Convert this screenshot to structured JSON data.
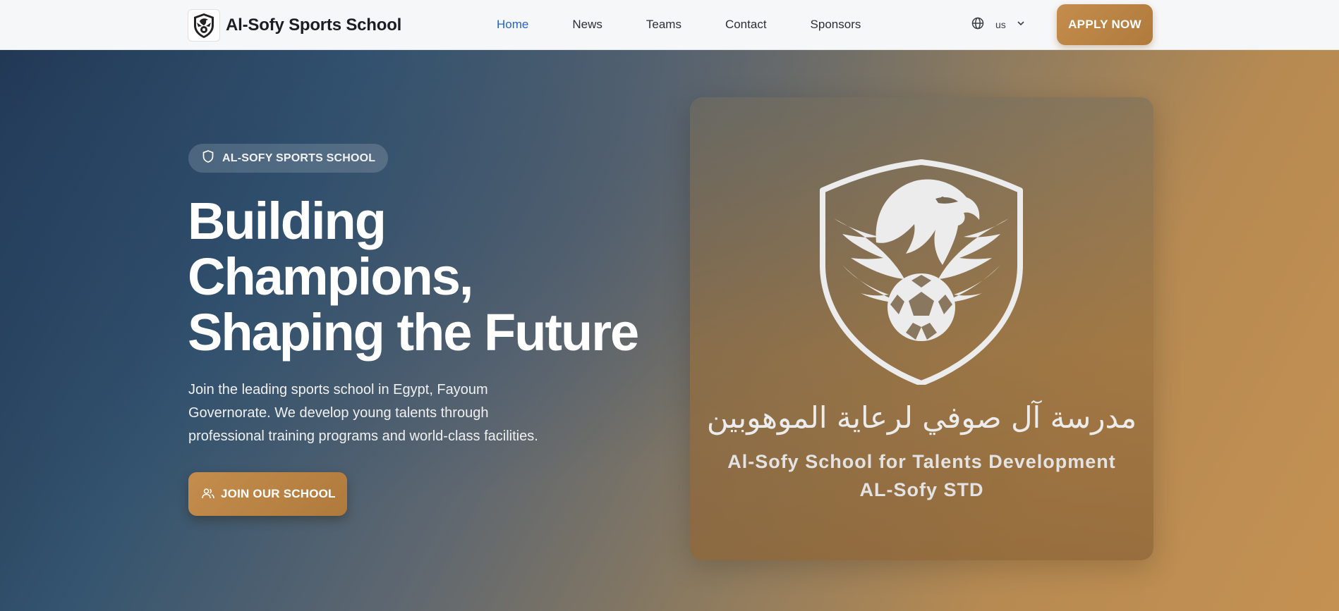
{
  "nav": {
    "brand_name": "Al-Sofy Sports School",
    "links": [
      {
        "label": "Home",
        "active": true
      },
      {
        "label": "News"
      },
      {
        "label": "Teams"
      },
      {
        "label": "Contact"
      },
      {
        "label": "Sponsors"
      }
    ],
    "language_icon": "globe-icon",
    "language_code": "us",
    "language_chevron": "chevron-down-icon",
    "apply_label": "APPLY NOW"
  },
  "hero": {
    "badge_icon": "shield-icon",
    "badge_label": "AL-SOFY SPORTS SCHOOL",
    "headline_lines": [
      "Building",
      "Champions,",
      "Shaping the Future"
    ],
    "description_lines": [
      "Join the leading sports school in Egypt, Fayoum",
      "Governorate. We develop young talents through",
      "professional training programs and world-class facilities."
    ],
    "join_icon": "users-icon",
    "join_label": "JOIN OUR SCHOOL"
  },
  "card": {
    "crest_icon": "eagle-football-crest",
    "arabic_name": "مدرسة آل صوفي لرعاية الموهوبين",
    "english_name": "Al-Sofy School for Talents Development",
    "short_name": "AL-Sofy STD"
  },
  "colors": {
    "accent": "#c48d4d",
    "nav_active": "#2563c9",
    "hero_dark": "#1f344e",
    "hero_warm": "#c59152"
  }
}
